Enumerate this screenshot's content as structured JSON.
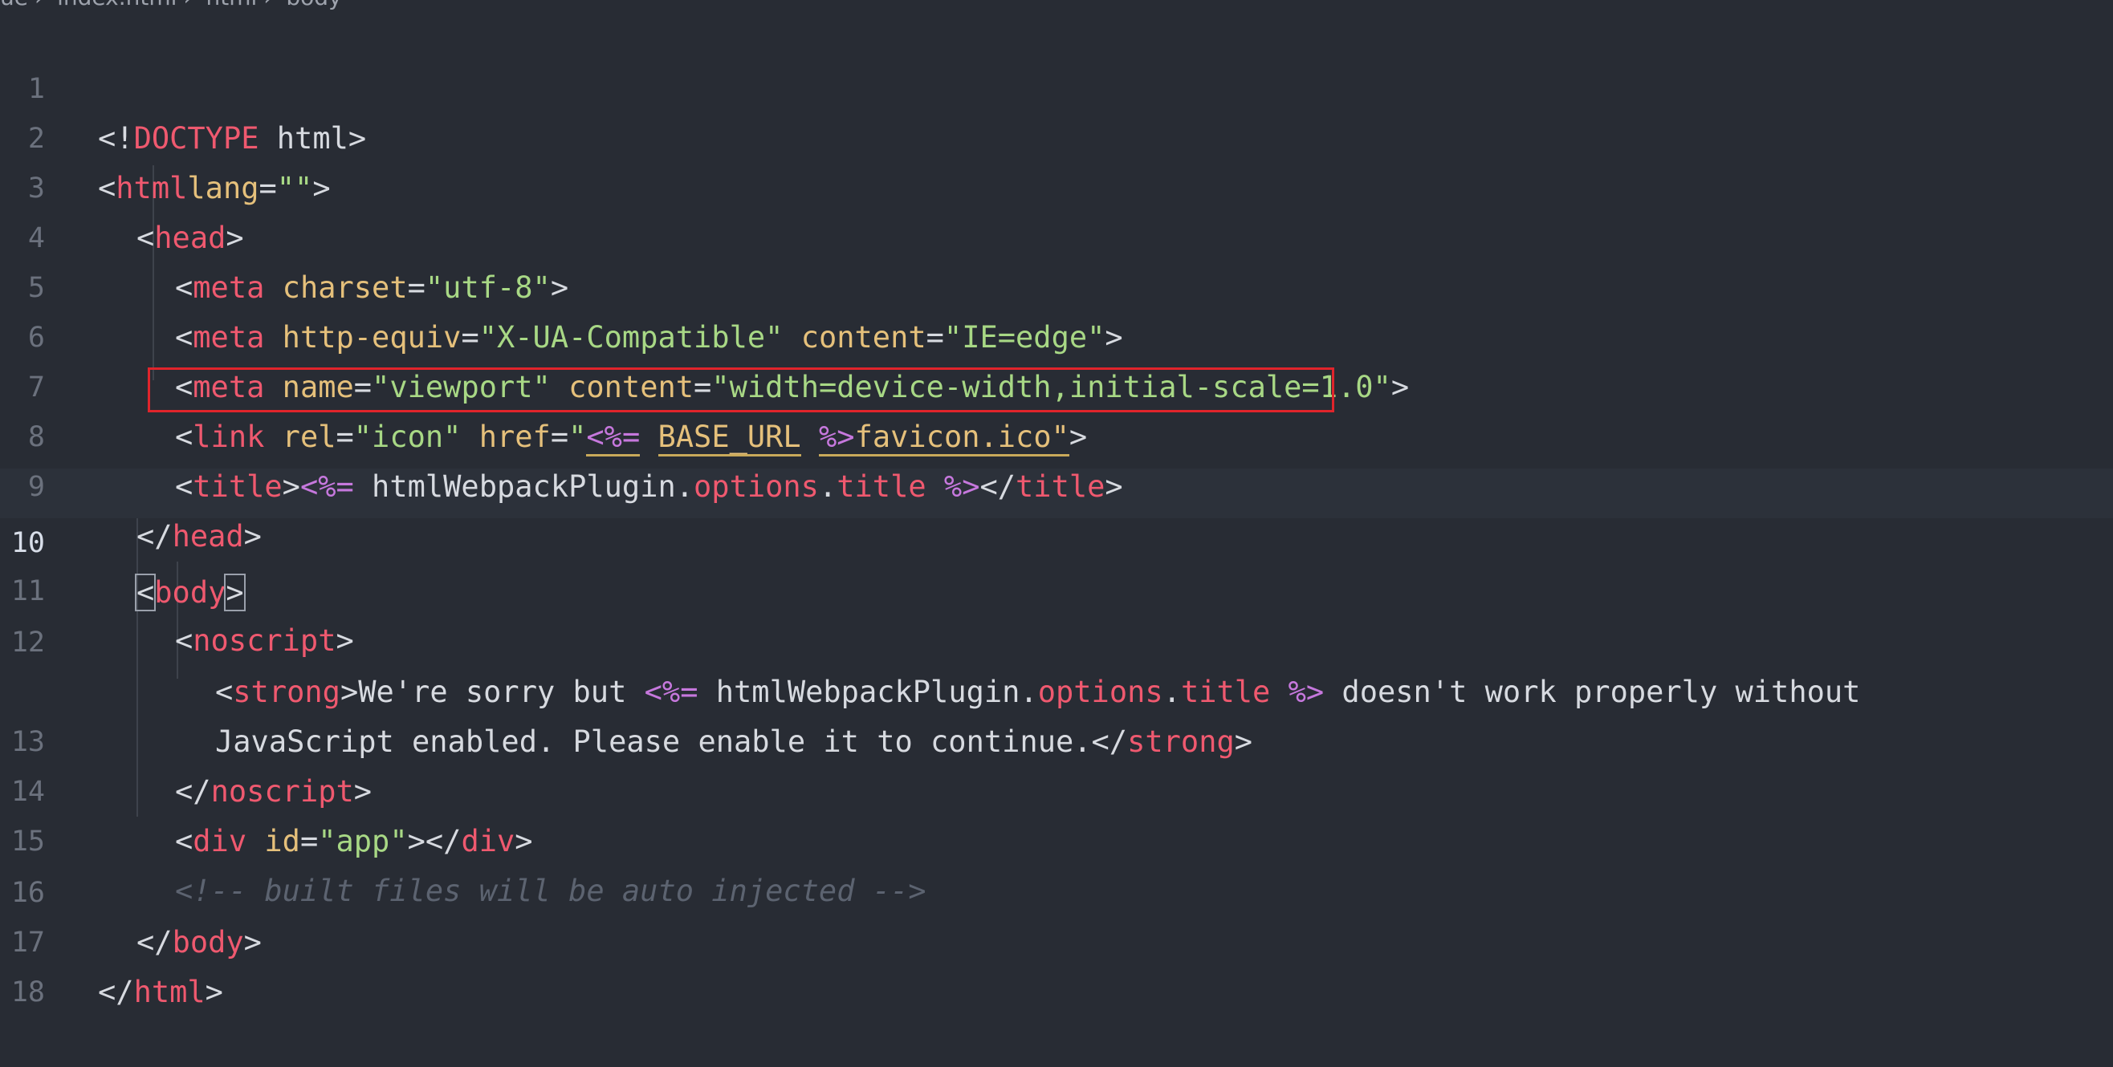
{
  "breadcrumb": [
    "ue",
    "index.html",
    "html",
    "body"
  ],
  "lines": [
    {
      "num": "1"
    },
    {
      "num": "2"
    },
    {
      "num": "3"
    },
    {
      "num": "4"
    },
    {
      "num": "5"
    },
    {
      "num": "6"
    },
    {
      "num": "7"
    },
    {
      "num": "8"
    },
    {
      "num": "9"
    },
    {
      "num": "10"
    },
    {
      "num": "11"
    },
    {
      "num": "12"
    },
    {
      "num": ""
    },
    {
      "num": "13"
    },
    {
      "num": "14"
    },
    {
      "num": "15"
    },
    {
      "num": "16"
    },
    {
      "num": "17"
    },
    {
      "num": "18"
    }
  ],
  "code": {
    "l1": {
      "p1": "<!",
      "tag": "DOCTYPE",
      "rest": " html>"
    },
    "l2": {
      "p1": "<",
      "tag": "html",
      "attr": "lang",
      "eq": "=",
      "val": "\"\"",
      "p2": ">"
    },
    "l3": {
      "p1": "<",
      "tag": "head",
      "p2": ">"
    },
    "l4": {
      "p1": "<",
      "tag": "meta",
      "attr": " charset",
      "eq": "=",
      "val": "\"utf-8\"",
      "p2": ">"
    },
    "l5": {
      "p1": "<",
      "tag": "meta",
      "attr1": " http-equiv",
      "eq1": "=",
      "val1": "\"X-UA-Compatible\"",
      "attr2": " content",
      "eq2": "=",
      "val2": "\"IE=edge\"",
      "p2": ">"
    },
    "l6": {
      "p1": "<",
      "tag": "meta",
      "attr1": " name",
      "eq1": "=",
      "val1": "\"viewport\"",
      "attr2": " content",
      "eq2": "=",
      "val2": "\"width=device-width,initial-scale=1.0\"",
      "p2": ">"
    },
    "l7": {
      "p1": "<",
      "tag": "link",
      "attr1": " rel",
      "eq1": "=",
      "val1": "\"icon\"",
      "attr2": " href",
      "eq2": "=",
      "q1": "\"",
      "tpl1": "<%=",
      "sp": " ",
      "var": "BASE_URL",
      "sp2": " ",
      "tpl2": "%>",
      "val2": "favicon.ico\"",
      "p2": ">"
    },
    "l8": {
      "p1": "<",
      "tag": "title",
      "p2": ">",
      "tpl1": "<%=",
      "text": " htmlWebpackPlugin.",
      "prop1": "options",
      "dot": ".",
      "prop2": "title",
      "tpl2": " %>",
      "p3": "</",
      "tag2": "title",
      "p4": ">"
    },
    "l9": {
      "p1": "</",
      "tag": "head",
      "p2": ">"
    },
    "l10": {
      "p1": "<",
      "tag": "body",
      "p2": ">"
    },
    "l11": {
      "p1": "<",
      "tag": "noscript",
      "p2": ">"
    },
    "l12a": {
      "p1": "<",
      "tag": "strong",
      "p2": ">",
      "text1": "We're sorry but ",
      "tpl1": "<%=",
      "text2": " htmlWebpackPlugin.",
      "prop1": "options",
      "dot": ".",
      "prop2": "title",
      "tpl2": " %>",
      "text3": " doesn't work properly without"
    },
    "l12b": {
      "text": "JavaScript enabled. Please enable it to continue.",
      "p1": "</",
      "tag": "strong",
      "p2": ">"
    },
    "l13": {
      "p1": "</",
      "tag": "noscript",
      "p2": ">"
    },
    "l14": {
      "p1": "<",
      "tag": "div",
      "attr": " id",
      "eq": "=",
      "val": "\"app\"",
      "p2": "></",
      "tag2": "div",
      "p3": ">"
    },
    "l15": {
      "comment": "<!-- built files will be auto injected -->"
    },
    "l16": {
      "p1": "</",
      "tag": "body",
      "p2": ">"
    },
    "l17": {
      "p1": "</",
      "tag": "html",
      "p2": ">"
    }
  }
}
